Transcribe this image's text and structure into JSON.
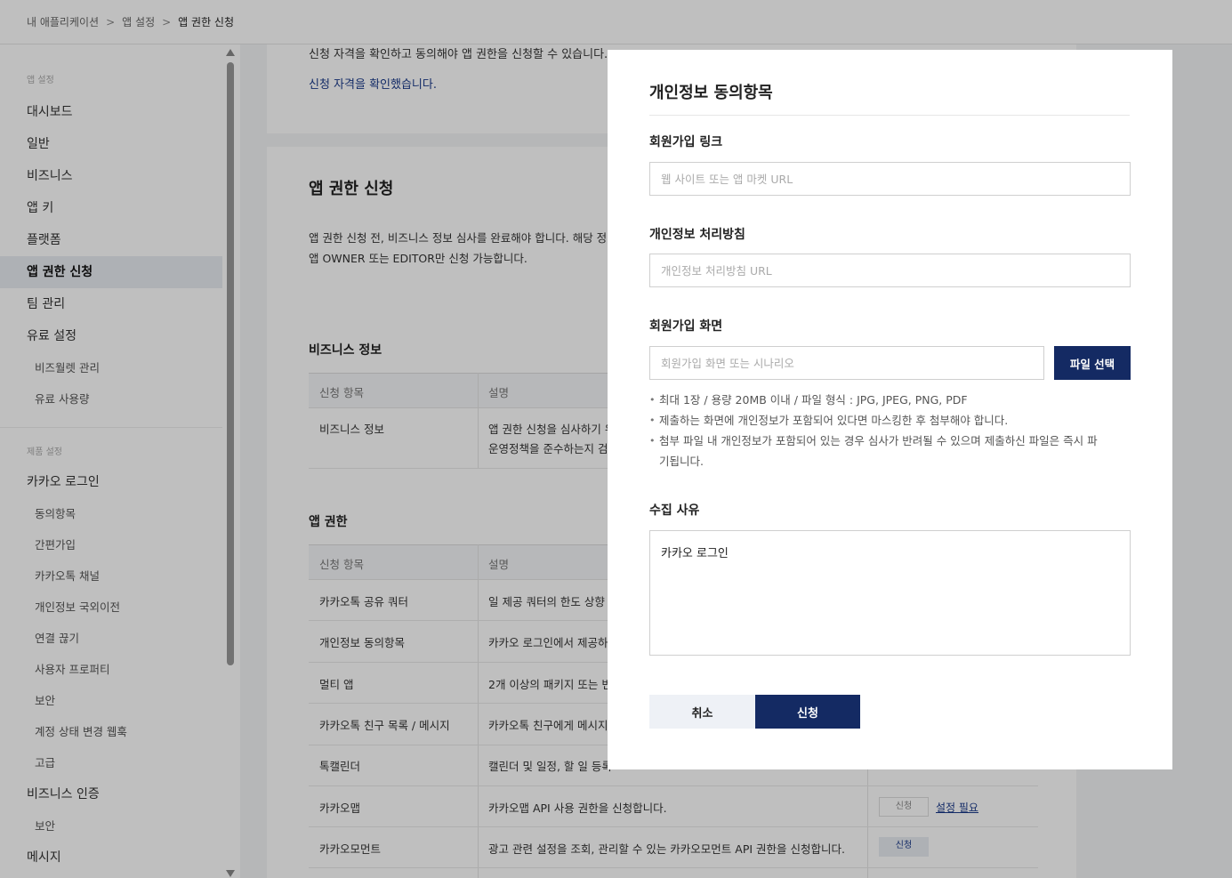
{
  "breadcrumb": {
    "items": [
      "내 애플리케이션",
      "앱 설정",
      "앱 권한 신청"
    ],
    "separator": ">"
  },
  "sidebar": {
    "section1_title": "앱 설정",
    "items": [
      "대시보드",
      "일반",
      "비즈니스",
      "앱 키",
      "플랫폼",
      "앱 권한 신청",
      "팀 관리",
      "유료 설정"
    ],
    "active_item": "앱 권한 신청",
    "paid_sub": [
      "비즈월렛 관리",
      "유료 사용량"
    ],
    "section2_title": "제품 설정",
    "kakao_login": "카카오 로그인",
    "kakao_sub": [
      "동의항목",
      "간편가입",
      "카카오톡 채널",
      "개인정보 국외이전",
      "연결 끊기",
      "사용자 프로퍼티",
      "보안",
      "계정 상태 변경 웹훅",
      "고급"
    ],
    "biz_auth": "비즈니스 인증",
    "biz_sub": [
      "보안"
    ],
    "message": "메시지"
  },
  "main": {
    "eligibility_text": "신청 자격을 확인하고 동의해야 앱 권한을 신청할 수 있습니다.",
    "eligibility_link": "신청 자격을 확인했습니다.",
    "section_title": "앱 권한 신청",
    "desc_line1": "앱 권한 신청 전, 비즈니스 정보 심사를 완료해야 합니다. 해당 정",
    "desc_line2": "앱 OWNER 또는 EDITOR만 신청 가능합니다.",
    "biz_info_title": "비즈니스 정보",
    "table_head_item": "신청 항목",
    "table_head_desc": "설명",
    "biz_row_item": "비즈니스 정보",
    "biz_row_desc1": "앱 권한 신청을 심사하기 위",
    "biz_row_desc2": "운영정책을 준수하는지 검",
    "app_perm_title": "앱 권한",
    "rows": [
      {
        "item": "카카오톡 공유 쿼터",
        "desc": "일 제공 쿼터의 한도 상향"
      },
      {
        "item": "개인정보 동의항목",
        "desc": "카카오 로그인에서 제공하"
      },
      {
        "item": "멀티 앱",
        "desc": "2개 이상의 패키지 또는 번"
      },
      {
        "item": "카카오톡 친구 목록 / 메시지",
        "desc": "카카오톡 친구에게 메시지"
      },
      {
        "item": "톡캘린더",
        "desc": "캘린더 및 일정, 할 일 등록"
      },
      {
        "item": "카카오맵",
        "desc": "카카오맵 API 사용 권한을 신청합니다."
      },
      {
        "item": "카카오모먼트",
        "desc": "광고 관련 설정을 조회, 관리할 수 있는 카카오모먼트 API 권한을 신청합니다."
      }
    ],
    "apply_label": "신청",
    "setting_required": "설정 필요"
  },
  "modal": {
    "title": "개인정보 동의항목",
    "signup_link_label": "회원가입 링크",
    "signup_link_placeholder": "웹 사이트 또는 앱 마켓 URL",
    "privacy_policy_label": "개인정보 처리방침",
    "privacy_policy_placeholder": "개인정보 처리방침 URL",
    "signup_screen_label": "회원가입 화면",
    "signup_screen_placeholder": "회원가입 화면 또는 시나리오",
    "file_button": "파일 선택",
    "notes": [
      "최대 1장 / 용량 20MB 이내 / 파일 형식 : JPG, JPEG, PNG, PDF",
      "제출하는 화면에 개인정보가 포함되어 있다면 마스킹한 후 첨부해야 합니다.",
      "첨부 파일 내 개인정보가 포함되어 있는 경우 심사가 반려될 수 있으며 제출하신 파일은 즉시 파기됩니다."
    ],
    "reason_label": "수집 사유",
    "reason_value": "카카오 로그인",
    "cancel_button": "취소",
    "submit_button": "신청"
  }
}
